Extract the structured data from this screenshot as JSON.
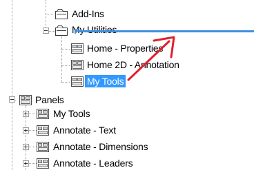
{
  "tree": {
    "add_ins": "Add-Ins",
    "my_utilities": "My Utilities",
    "home_properties": "Home - Properties",
    "home_2d_annotation": "Home 2D - Annotation",
    "my_tools_selected": "My Tools",
    "panels": "Panels",
    "panels_my_tools": "My Tools",
    "annotate_text": "Annotate - Text",
    "annotate_dimensions": "Annotate - Dimensions",
    "annotate_leaders": "Annotate - Leaders"
  },
  "icons": {
    "tab_icon": "ribbon-tab-icon",
    "panel_icon": "ribbon-panel-icon",
    "drag_arrow": "red-drag-arrow"
  },
  "colors": {
    "selection": "#3399ff",
    "insert_marker": "#3d8fe0",
    "drag_arrow": "#e0202a"
  }
}
